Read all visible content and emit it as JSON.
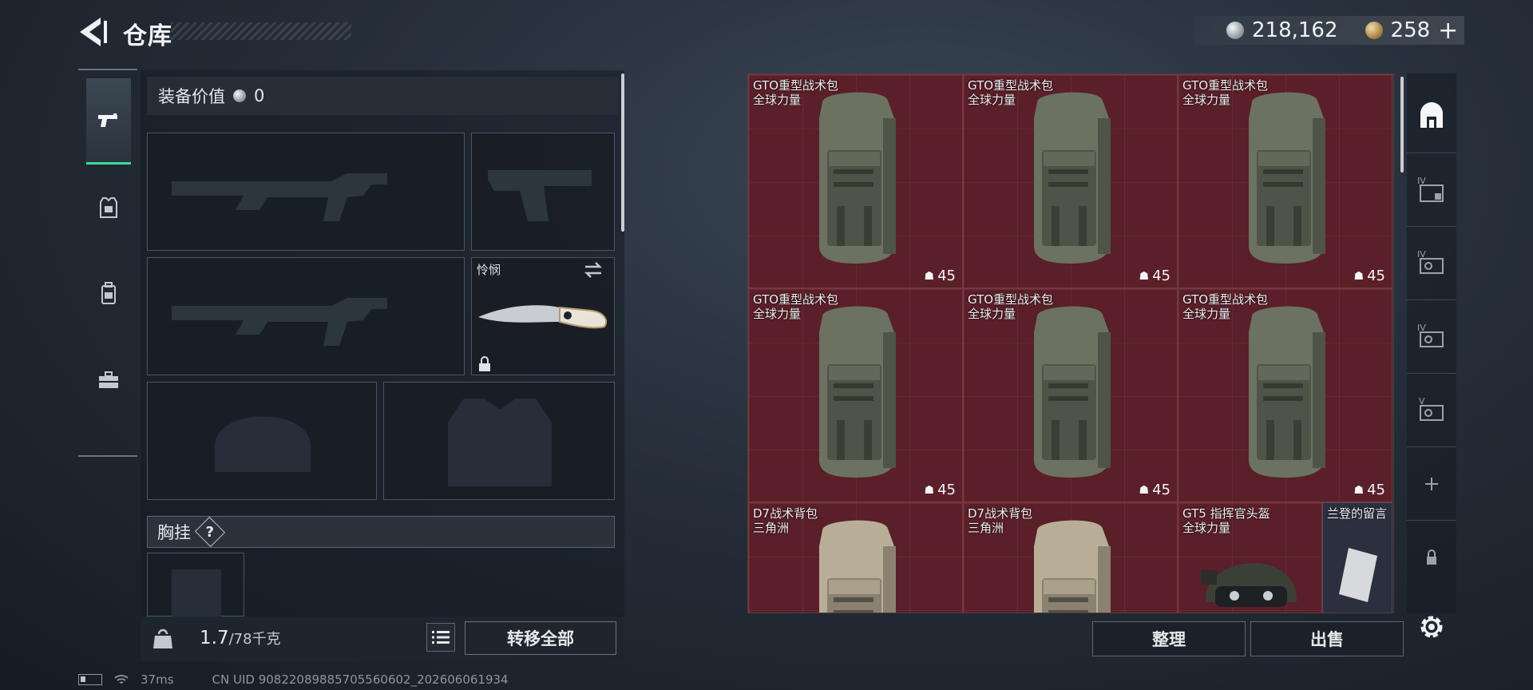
{
  "header": {
    "title": "仓库",
    "currency": [
      {
        "icon": "silver-coin-icon",
        "amount": "218,162"
      },
      {
        "icon": "gold-coin-icon",
        "amount": "258"
      }
    ],
    "add_symbol": "+"
  },
  "left_tabs": [
    {
      "icon": "pistol-icon",
      "active": true
    },
    {
      "icon": "armor-icon",
      "active": false
    },
    {
      "icon": "backpack-icon",
      "active": false
    },
    {
      "icon": "toolbox-icon",
      "active": false
    }
  ],
  "equipment": {
    "value_label": "装备价值",
    "value_amount": "0",
    "knife_label": "怜悯",
    "chest_label": "胸挂",
    "chest_help": "?"
  },
  "footer_left": {
    "weight_current": "1.7",
    "weight_max": "/78千克",
    "transfer_label": "转移全部"
  },
  "status": {
    "ping": "37ms",
    "uid": "CN UID 9082208988570556060​2_202606061934"
  },
  "storage": {
    "items": [
      {
        "name": "GTO重型战术包",
        "origin": "全球力量",
        "qty": "45",
        "kind": "backpack-green"
      },
      {
        "name": "GTO重型战术包",
        "origin": "全球力量",
        "qty": "45",
        "kind": "backpack-green"
      },
      {
        "name": "GTO重型战术包",
        "origin": "全球力量",
        "qty": "45",
        "kind": "backpack-green"
      },
      {
        "name": "GTO重型战术包",
        "origin": "全球力量",
        "qty": "45",
        "kind": "backpack-green"
      },
      {
        "name": "GTO重型战术包",
        "origin": "全球力量",
        "qty": "45",
        "kind": "backpack-green"
      },
      {
        "name": "GTO重型战术包",
        "origin": "全球力量",
        "qty": "45",
        "kind": "backpack-green"
      },
      {
        "name": "D7战术背包",
        "origin": "三角洲",
        "qty": "",
        "kind": "backpack-tan"
      },
      {
        "name": "D7战术背包",
        "origin": "三角洲",
        "qty": "",
        "kind": "backpack-tan"
      },
      {
        "name": "GT5 指挥官头盔",
        "origin": "全球力量",
        "qty": "",
        "kind": "helmet"
      }
    ],
    "note_item": {
      "name": "兰登的留言",
      "kind": "note"
    }
  },
  "right_tabs": [
    {
      "icon": "safe-box-icon",
      "label": ""
    },
    {
      "icon": "storage-tier-iv-icon-1",
      "label": "IV"
    },
    {
      "icon": "storage-tier-iv-icon-2",
      "label": "IV"
    },
    {
      "icon": "storage-tier-iv-icon-3",
      "label": "IV"
    },
    {
      "icon": "storage-tier-v-icon",
      "label": "V"
    },
    {
      "icon": "add-storage-icon",
      "label": "+"
    },
    {
      "icon": "locked-storage-icon",
      "label": ""
    }
  ],
  "footer_right": {
    "sort_label": "整理",
    "sell_label": "出售"
  }
}
